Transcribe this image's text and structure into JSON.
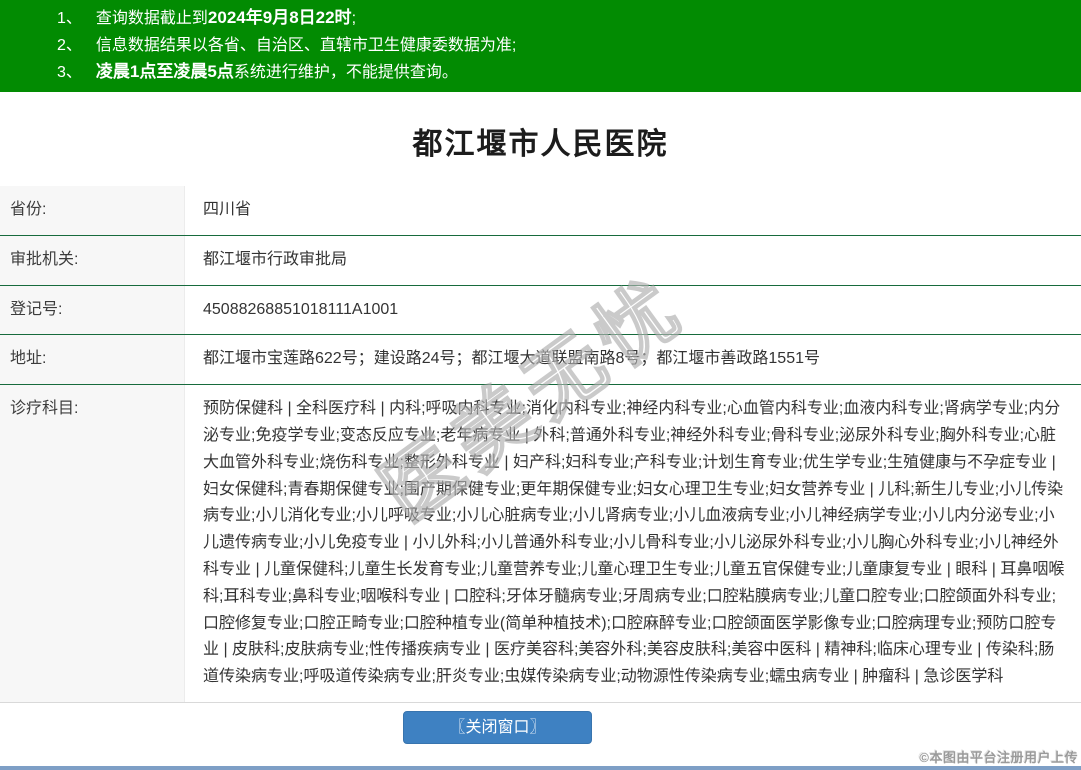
{
  "notice": {
    "items": [
      {
        "num": "1、",
        "pre": "查询数据截止到",
        "bold": "2024年9月8日22时",
        "post": ";"
      },
      {
        "num": "2、",
        "pre": "信息数据结果以各省、自治区、直辖市卫生健康委数据为准;",
        "bold": "",
        "post": ""
      },
      {
        "num": "3、",
        "pre": "",
        "bold": "凌晨1点至凌晨5点",
        "post": "系统进行维护，不能提供查询。"
      }
    ]
  },
  "hospital": {
    "title": "都江堰市人民医院"
  },
  "fields": [
    {
      "label": "省份:",
      "value": "四川省"
    },
    {
      "label": "审批机关:",
      "value": "都江堰市行政审批局"
    },
    {
      "label": "登记号:",
      "value": "45088268851018111A1001"
    },
    {
      "label": "地址:",
      "value": "都江堰市宝莲路622号；建设路24号；都江堰大道联盟南路8号；都江堰市善政路1551号"
    },
    {
      "label": "诊疗科目:",
      "value": "预防保健科 | 全科医疗科 | 内科;呼吸内科专业;消化内科专业;神经内科专业;心血管内科专业;血液内科专业;肾病学专业;内分泌专业;免疫学专业;变态反应专业;老年病专业 | 外科;普通外科专业;神经外科专业;骨科专业;泌尿外科专业;胸外科专业;心脏大血管外科专业;烧伤科专业;整形外科专业 | 妇产科;妇科专业;产科专业;计划生育专业;优生学专业;生殖健康与不孕症专业 | 妇女保健科;青春期保健专业;围产期保健专业;更年期保健专业;妇女心理卫生专业;妇女营养专业 | 儿科;新生儿专业;小儿传染病专业;小儿消化专业;小儿呼吸专业;小儿心脏病专业;小儿肾病专业;小儿血液病专业;小儿神经病学专业;小儿内分泌专业;小儿遗传病专业;小儿免疫专业 | 小儿外科;小儿普通外科专业;小儿骨科专业;小儿泌尿外科专业;小儿胸心外科专业;小儿神经外科专业 | 儿童保健科;儿童生长发育专业;儿童营养专业;儿童心理卫生专业;儿童五官保健专业;儿童康复专业 | 眼科 | 耳鼻咽喉科;耳科专业;鼻科专业;咽喉科专业 | 口腔科;牙体牙髓病专业;牙周病专业;口腔粘膜病专业;儿童口腔专业;口腔颌面外科专业;口腔修复专业;口腔正畸专业;口腔种植专业(简单种植技术);口腔麻醉专业;口腔颌面医学影像专业;口腔病理专业;预防口腔专业 | 皮肤科;皮肤病专业;性传播疾病专业 | 医疗美容科;美容外科;美容皮肤科;美容中医科 | 精神科;临床心理专业 | 传染科;肠道传染病专业;呼吸道传染病专业;肝炎专业;虫媒传染病专业;动物源性传染病专业;蠕虫病专业 | 肿瘤科 | 急诊医学科"
    }
  ],
  "watermark": {
    "text": "医美无忧"
  },
  "footer": {
    "close_button": "〖关闭窗口〗",
    "credit": "©本图由平台注册用户上传"
  },
  "colors": {
    "banner_green": "#028b02",
    "table_border_green": "#176b3d",
    "label_bg_gray": "#f7f7f7",
    "button_blue": "#3e81c2",
    "bottom_strip_blue": "#7e9fc6"
  }
}
